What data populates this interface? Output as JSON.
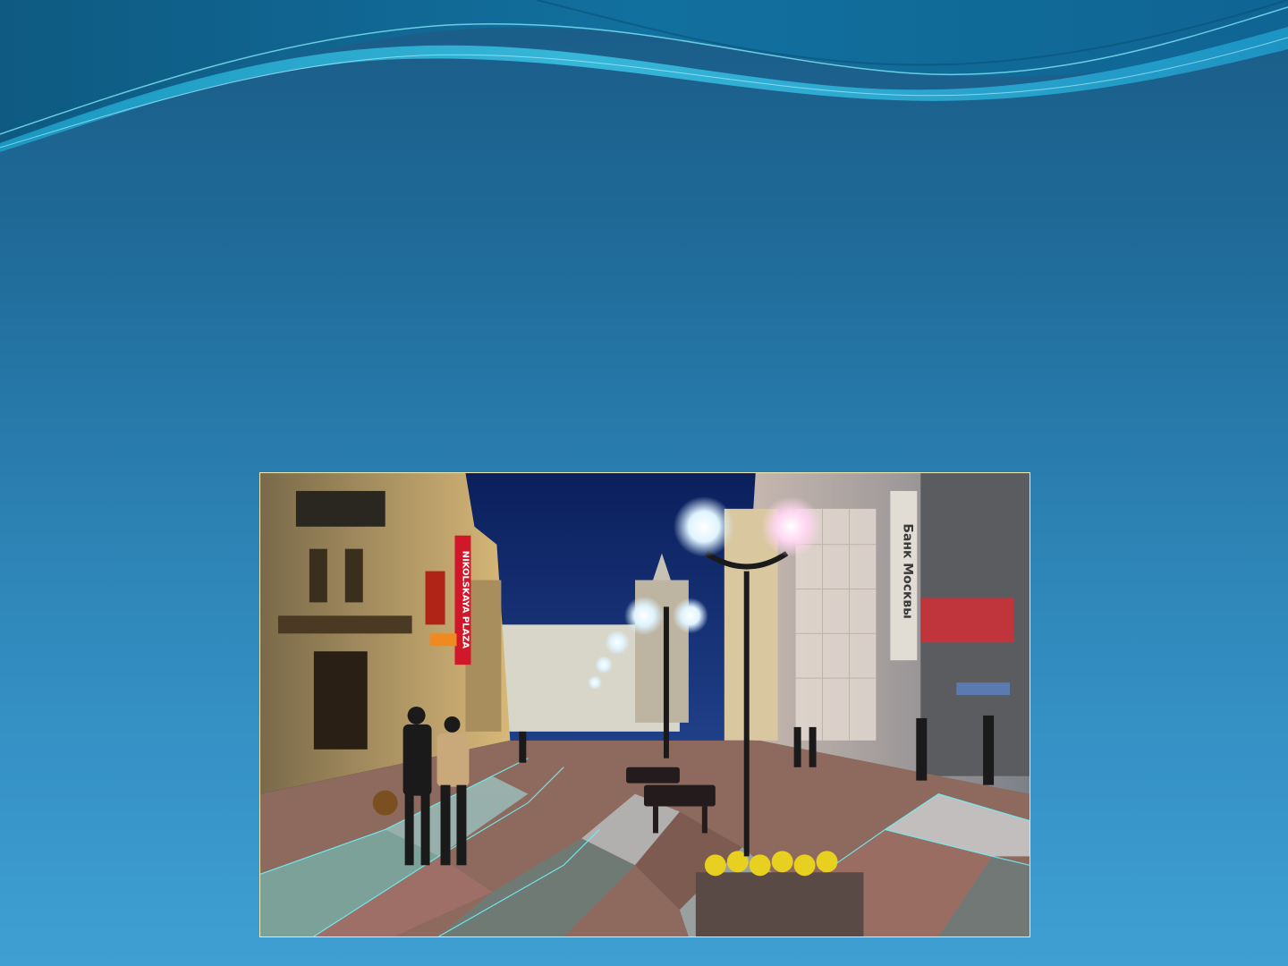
{
  "slide": {
    "background_top": "#1a5c88",
    "background_bottom": "#3f9fd3",
    "wave_accent": "#2fc8e8"
  },
  "photo": {
    "subject": "street-scene-photo",
    "signs": {
      "left_vertical": "NIKOLSKAYA PLAZA",
      "right_vertical": "Банк Москвы"
    },
    "frame_color": "#f2eab0"
  }
}
